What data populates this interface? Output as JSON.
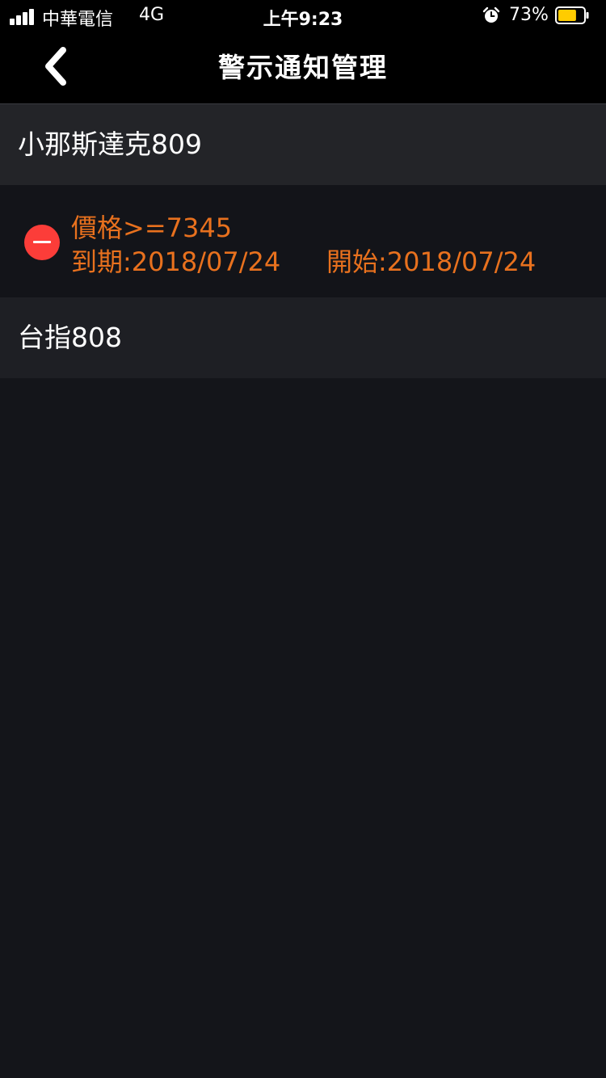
{
  "status_bar": {
    "carrier": "中華電信",
    "network": "4G",
    "time": "上午9:23",
    "battery_percent": "73%",
    "battery_level": 0.73,
    "battery_color": "#ffcc00",
    "icons": [
      "signal-icon",
      "alarm-icon",
      "battery-icon"
    ]
  },
  "nav": {
    "back_icon": "chevron-left-icon",
    "title": "警示通知管理"
  },
  "groups": [
    {
      "label": "小那斯達克809",
      "alerts": [
        {
          "condition": "價格>=7345",
          "expiry": "到期:2018/07/24",
          "start": "開始:2018/07/24",
          "delete_icon": "minus-circle-icon"
        }
      ]
    },
    {
      "label": "台指808",
      "alerts": []
    }
  ],
  "colors": {
    "alert_text": "#e8711e",
    "delete": "#fc3d39",
    "background": "#14151a"
  }
}
